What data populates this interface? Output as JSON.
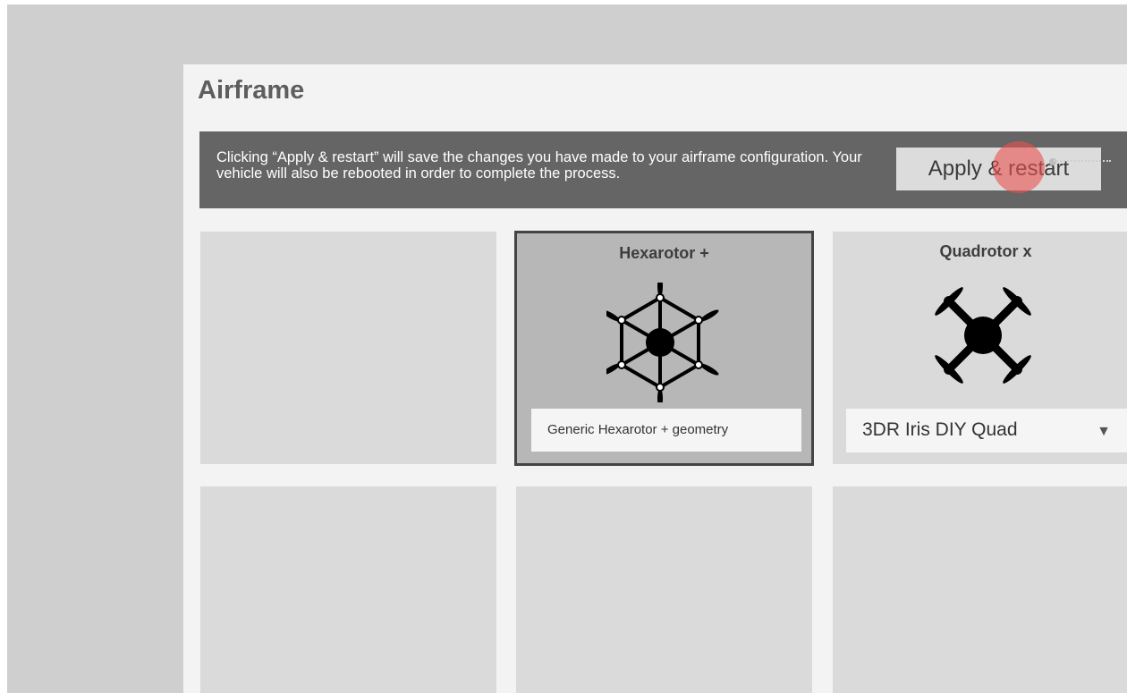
{
  "page": {
    "title": "Airframe"
  },
  "banner": {
    "message": "Clicking “Apply & restart” will save the changes you have made to your airframe configuration. Your vehicle will also be rebooted in order to complete the process.",
    "apply_label": "Apply & restart"
  },
  "tiles": [
    {
      "name": "",
      "config": ""
    },
    {
      "name": "Hexarotor +",
      "config": "Generic Hexarotor + geometry",
      "selected": true,
      "icon": "hexarotor-plus-icon"
    },
    {
      "name": "Quadrotor x",
      "config": "3DR Iris DIY Quad",
      "has_dropdown": true,
      "icon": "quadrotor-x-icon"
    }
  ],
  "colors": {
    "banner": "#656565",
    "selected_border": "#444444",
    "tile": "#dadada",
    "click_marker": "#eb5050"
  },
  "icons": {
    "dropdown": "triangle-down"
  }
}
